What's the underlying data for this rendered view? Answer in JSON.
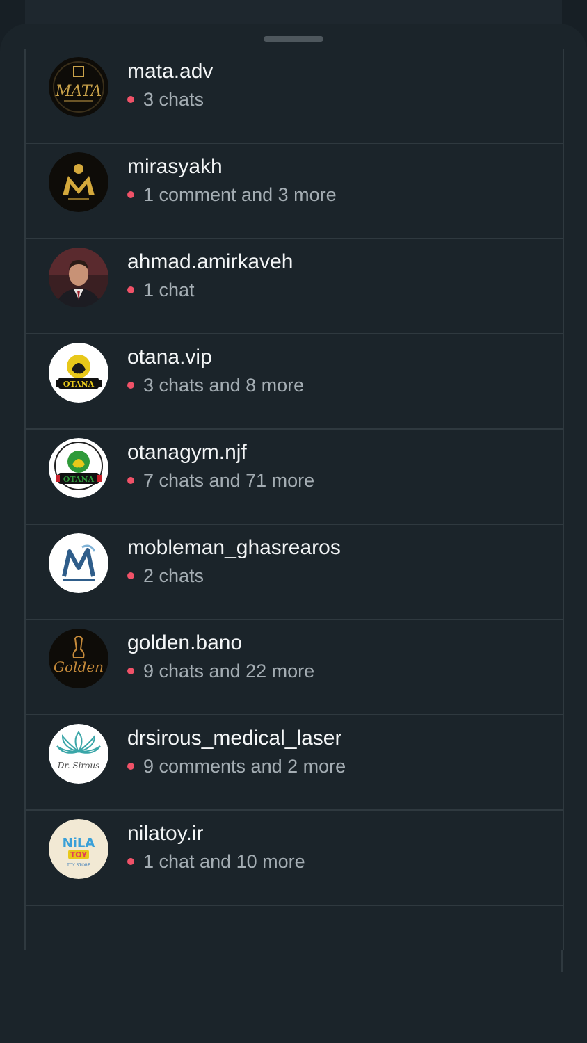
{
  "accounts": [
    {
      "username": "mata.adv",
      "activity": "3 chats",
      "avatar": {
        "bg": "#0e0c08",
        "accent": "#c9a24a",
        "mark": "MATA"
      }
    },
    {
      "username": "mirasyakh",
      "activity": "1 comment and 3 more",
      "avatar": {
        "bg": "#0e0c08",
        "accent": "#d4a93c",
        "mark": "M"
      }
    },
    {
      "username": "ahmad.amirkaveh",
      "activity": "1 chat",
      "avatar": {
        "bg": "#3a1f22",
        "accent": "#b8826a",
        "mark": "portrait"
      }
    },
    {
      "username": "otana.vip",
      "activity": "3 chats and 8 more",
      "avatar": {
        "bg": "#ffffff",
        "accent": "#e8c81a",
        "mark": "OTANA"
      }
    },
    {
      "username": "otanagym.njf",
      "activity": "7 chats and 71 more",
      "avatar": {
        "bg": "#ffffff",
        "accent": "#2f9a3a",
        "mark": "OTANA"
      }
    },
    {
      "username": "mobleman_ghasrearos",
      "activity": "2 chats",
      "avatar": {
        "bg": "#ffffff",
        "accent": "#2f5d8a",
        "mark": "M"
      }
    },
    {
      "username": "golden.bano",
      "activity": "9 chats and 22 more",
      "avatar": {
        "bg": "#0e0c08",
        "accent": "#c58a3a",
        "mark": "Golden"
      }
    },
    {
      "username": "drsirous_medical_laser",
      "activity": "9 comments and 2 more",
      "avatar": {
        "bg": "#ffffff",
        "accent": "#3aa6a8",
        "mark": "lotus"
      }
    },
    {
      "username": "nilatoy.ir",
      "activity": "1 chat and 10 more",
      "avatar": {
        "bg": "#f2e9d4",
        "accent": "#e23a5a",
        "mark": "NILA"
      }
    }
  ],
  "colors": {
    "unread_dot": "#f05268",
    "username_text": "#f3f5f6",
    "activity_text": "#a4adb3",
    "sheet_bg": "#1b242a",
    "divider": "#2f393f"
  }
}
